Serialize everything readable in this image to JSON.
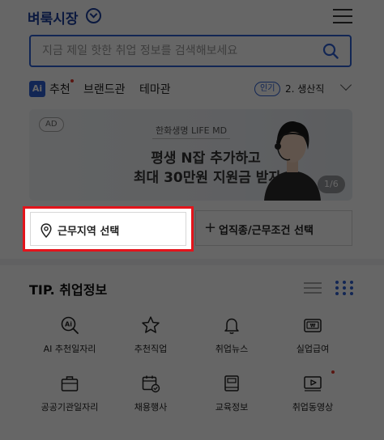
{
  "header": {
    "brand": "벼룩시장",
    "brand_menu_icon": "chevron-down-circle-icon",
    "menu_icon": "hamburger-menu-icon"
  },
  "search": {
    "placeholder": "지금 제일 핫한 취업 정보를 검색해보세요",
    "icon": "search-icon",
    "accent_color": "#2d5fd3"
  },
  "tabs": {
    "ai_badge": "Ai",
    "items": [
      {
        "label": "추천"
      },
      {
        "label": "브랜드관"
      },
      {
        "label": "테마관"
      }
    ],
    "hot_badge": "인기",
    "ranking_text": "2. 생산직"
  },
  "banner": {
    "ad_tag": "AD",
    "sub": "한화생명 LIFE MD",
    "line1": "평생 N잡 추가하고",
    "line2": "최대 30만원 지원금 받자",
    "pager": "1/6"
  },
  "filters": {
    "location_label": "근무지역 선택",
    "job_label": "업직종/근무조건 선택",
    "highlight_color": "#e3141b"
  },
  "tip": {
    "title": "TIP. 취업정보",
    "items": [
      {
        "label": "AI 추천일자리",
        "icon": "ai-search-icon"
      },
      {
        "label": "추천직업",
        "icon": "star-icon"
      },
      {
        "label": "취업뉴스",
        "icon": "bell-icon"
      },
      {
        "label": "실업급여",
        "icon": "wallet-icon"
      },
      {
        "label": "공공기관일자리",
        "icon": "briefcase-icon"
      },
      {
        "label": "채용행사",
        "icon": "calendar-check-icon"
      },
      {
        "label": "교육정보",
        "icon": "book-icon"
      },
      {
        "label": "취업동영상",
        "icon": "video-icon"
      }
    ]
  }
}
